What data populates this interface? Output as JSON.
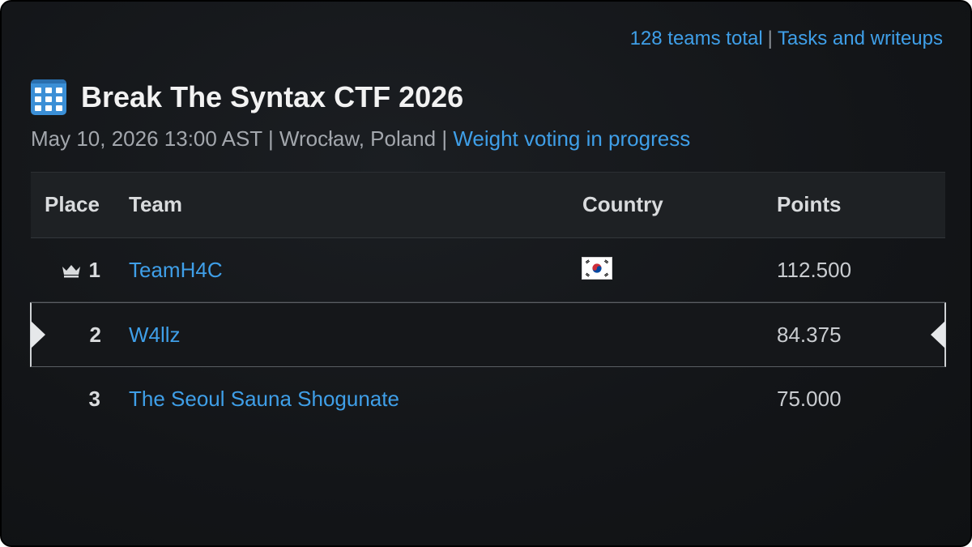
{
  "header_links": {
    "teams_total": "128 teams total",
    "separator": "|",
    "tasks": "Tasks and writeups"
  },
  "event": {
    "icon": "calendar-icon",
    "title": "Break The Syntax CTF 2026",
    "date_location": "May 10, 2026 13:00 AST | Wrocław, Poland |",
    "weight_link": "Weight voting in progress"
  },
  "table": {
    "headers": {
      "place": "Place",
      "team": "Team",
      "country": "Country",
      "points": "Points"
    },
    "rows": [
      {
        "place": "1",
        "team": "TeamH4C",
        "country": "south-korea-flag",
        "points": "112.500",
        "icon": "crown-icon"
      },
      {
        "place": "2",
        "team": "W4llz",
        "country": "",
        "points": "84.375"
      },
      {
        "place": "3",
        "team": "The Seoul Sauna Shogunate",
        "country": "",
        "points": "75.000"
      }
    ]
  },
  "colors": {
    "link": "#3f9fe8",
    "background": "#131518",
    "header_bg": "#1e2124"
  }
}
